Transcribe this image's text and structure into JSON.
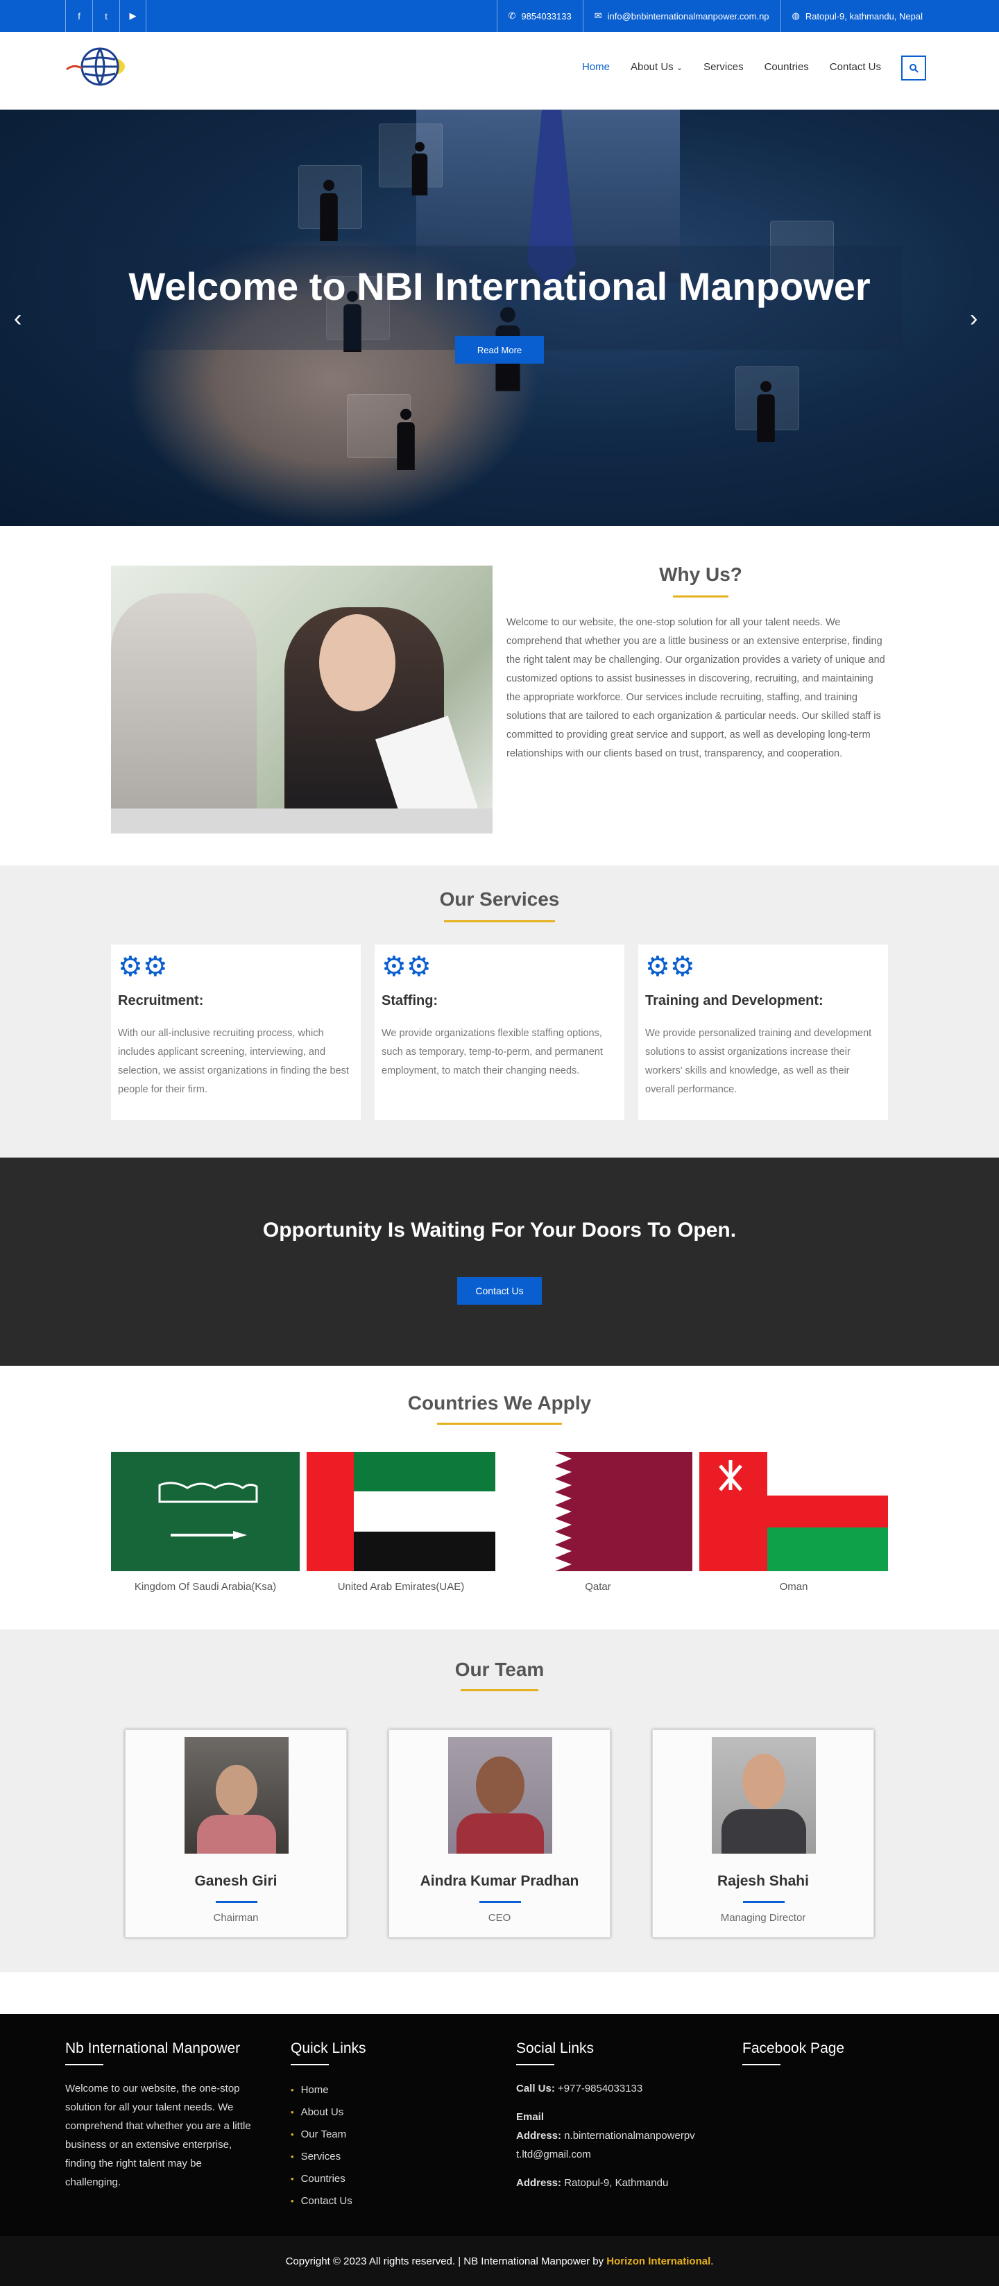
{
  "topbar": {
    "phone": "9854033133",
    "email": "info@bnbinternationalmanpower.com.np",
    "address": "Ratopul-9, kathmandu, Nepal"
  },
  "nav": {
    "items": [
      "Home",
      "About Us",
      "Services",
      "Countries",
      "Contact Us"
    ]
  },
  "hero": {
    "title": "Welcome to NBI International Manpower",
    "button": "Read More"
  },
  "why": {
    "title": "Why Us?",
    "text": "Welcome to our website, the one-stop solution for all your talent needs. We comprehend that whether you are a little business or an extensive enterprise, finding the right talent may be challenging. Our organization provides a variety of unique and customized options to assist businesses in discovering, recruiting, and maintaining the appropriate workforce. Our services include recruiting, staffing, and training solutions that are tailored to each organization & particular needs. Our skilled staff is committed to providing great service and support, as well as developing long-term relationships with our clients based on trust, transparency, and cooperation."
  },
  "services": {
    "title": "Our Services",
    "items": [
      {
        "title": "Recruitment:",
        "text": "With our all-inclusive recruiting process, which includes applicant screening, interviewing, and selection, we assist organizations in finding the best people for their firm."
      },
      {
        "title": "Staffing:",
        "text": "We provide organizations flexible staffing options, such as temporary, temp-to-perm, and permanent employment, to match their changing needs."
      },
      {
        "title": "Training and Development:",
        "text": "We provide personalized training and development solutions to assist organizations increase their workers' skills and knowledge, as well as their overall performance."
      }
    ]
  },
  "cta": {
    "title": "Opportunity Is Waiting For Your Doors To Open.",
    "button": "Contact Us"
  },
  "countries": {
    "title": "Countries We Apply",
    "items": [
      "Kingdom Of Saudi Arabia(Ksa)",
      "United Arab Emirates(UAE)",
      "Qatar",
      "Oman"
    ]
  },
  "team": {
    "title": "Our Team",
    "members": [
      {
        "name": "Ganesh Giri",
        "role": "Chairman"
      },
      {
        "name": "Aindra Kumar Pradhan",
        "role": "CEO"
      },
      {
        "name": "Rajesh Shahi",
        "role": "Managing Director"
      }
    ]
  },
  "footer": {
    "about_title": "Nb International Manpower",
    "about_text": "Welcome to our website, the one-stop solution for all your talent needs. We comprehend that whether you are a little business or an extensive enterprise, finding the right talent may be challenging.",
    "links_title": "Quick Links",
    "links": [
      "Home",
      "About Us",
      "Our Team",
      "Services",
      "Countries",
      "Contact Us"
    ],
    "social_title": "Social Links",
    "call_label": "Call Us:",
    "call_value": "+977-9854033133",
    "email_label": "Email",
    "email_address_label": "Address:",
    "email_line1": "n.binternationalmanpowerpv",
    "email_line2": "t.ltd@gmail.com",
    "address_label": "Address:",
    "address_value": "Ratopul-9, Kathmandu",
    "fb_title": "Facebook Page"
  },
  "copyright": {
    "text": "Copyright © 2023 All rights reserved. | NB International Manpower by",
    "brand": "Horizon International",
    "end": "."
  }
}
